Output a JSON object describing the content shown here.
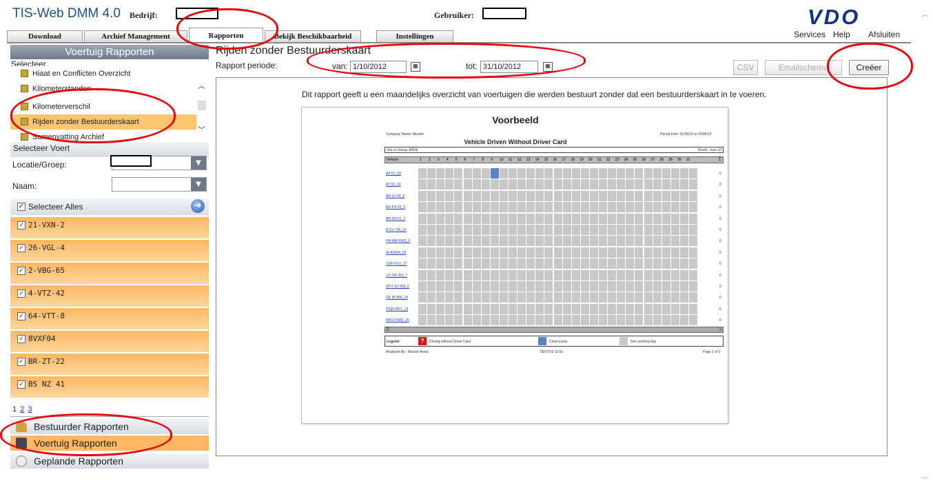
{
  "header": {
    "app_title": "TIS-Web DMM 4.0",
    "company_label": "Bedrijf:",
    "user_label": "Gebruiker:",
    "logo": "VDO",
    "links": [
      "Services",
      "Help",
      "Afsluiten"
    ]
  },
  "tabs": [
    "Download",
    "Archief Management",
    "Rapporten",
    "Bekijk Beschikbaarheid",
    "Instellingen"
  ],
  "sidebar": {
    "title": "Voertuig Rapporten",
    "select_label": "Selecteer",
    "reports": [
      "Hiaat en Conflicten Overzicht",
      "Kilometerstanden",
      "Kilometerverschil",
      "Rijden zonder Bestuurderskaart",
      "Samenvatting Archief"
    ],
    "selected_report": 3,
    "select_vehicle_label": "Selecteer Voert",
    "location_label": "Locatie/Groep:",
    "name_label": "Naam:",
    "select_all_label": "Selecteer Alles",
    "vehicles": [
      "21-VXN-2",
      "26-VGL-4",
      "2-VBG-65",
      "4-VTZ-42",
      "64-VTT-8",
      "8VXF04",
      "BR-ZT-22",
      "BS NZ 41"
    ],
    "pages": [
      "1",
      "2",
      "3"
    ],
    "sections": [
      "Bestuurder Rapporten",
      "Voertuig Rapporten",
      "Geplande Rapporten"
    ]
  },
  "main": {
    "title": "Rijden zonder Bestuurderskaart",
    "period_label": "Rapport periode:",
    "from_label": "van:",
    "from_value": "1/10/2012",
    "to_label": "tot:",
    "to_value": "31/10/2012",
    "buttons": [
      "CSV",
      "Emailschema",
      "Creëer"
    ],
    "description": "Dit rapport geeft u een maandelijks overzicht van voertuigen die werden bestuurt zonder dat een bestuurderskaart in te voeren."
  },
  "preview": {
    "title": "Voorbeeld",
    "company": "Company Name: Munish",
    "period": "Period from: 01/06/10 to 30/06/10",
    "report_title": "Vehicle Driven Without Driver Card",
    "site": "Site or Group: BASE",
    "month": "Month: June 10",
    "vehicle_col": "Vehicle",
    "days": [
      "1",
      "2",
      "3",
      "4",
      "5",
      "6",
      "7",
      "8",
      "9",
      "10",
      "11",
      "12",
      "13",
      "14",
      "15",
      "16",
      "17",
      "18",
      "19",
      "20",
      "21",
      "22",
      "23",
      "24",
      "25",
      "26",
      "27",
      "28",
      "29",
      "30",
      "31"
    ],
    "sum_symbol": "Σ",
    "vehicles": [
      "AX 53_20",
      "AY 52_20",
      "BR-LF-94_6",
      "BR-PX-23_5",
      "BR-SH-51_2",
      "B-SV 790_25",
      "HH-MM 6905_5",
      "IA-A2004_29",
      "J180 PLG_27",
      "LO ZW 253_7",
      "MTX SV 658_6",
      "OE 95 896_24",
      "PS35 RKY_19",
      "RW-CH366_26"
    ],
    "row_totals": [
      "0",
      "0",
      "0",
      "0",
      "0",
      "0",
      "0",
      "0",
      "0",
      "0",
      "0",
      "0",
      "0",
      "0"
    ],
    "footer_total": "0",
    "legend_label": "Legend:",
    "legend_items": [
      "Driving without Driver Card",
      "Chart exists",
      "Non working day"
    ],
    "legend_marker": "?",
    "analysed_by": "Analysed By : Munish Arora",
    "timestamp": "05/07/10 11:50",
    "page_info": "Page 1 of 2"
  },
  "colors": {
    "accent_orange": "#fcc66e",
    "header_blue": "#1a4f8b",
    "annotation_red": "#e8000b",
    "chart_exists_blue": "#5b82c8",
    "grid_grey": "#c8c8c8",
    "legend_red": "#dd1111"
  }
}
